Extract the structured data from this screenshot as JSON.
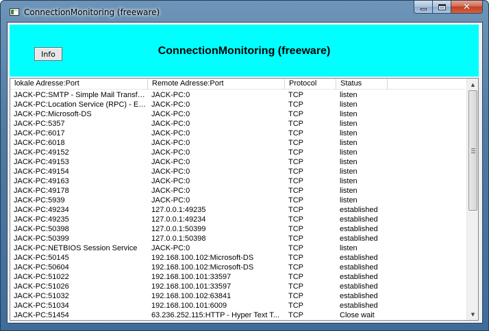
{
  "window": {
    "title": "ConnectionMonitoring (freeware)"
  },
  "header": {
    "info_label": "Info",
    "heading": "ConnectionMonitoring (freeware)",
    "background_color": "#00ffff"
  },
  "table": {
    "columns": [
      "lokale Adresse:Port",
      "Remote Adresse:Port",
      "Protocol",
      "Status"
    ],
    "rows": [
      [
        "JACK-PC:SMTP - Simple Mail Transfer ...",
        "JACK-PC:0",
        "TCP",
        "listen"
      ],
      [
        "JACK-PC:Location Service (RPC) - EP...",
        "JACK-PC:0",
        "TCP",
        "listen"
      ],
      [
        "JACK-PC:Microsoft-DS",
        "JACK-PC:0",
        "TCP",
        "listen"
      ],
      [
        "JACK-PC:5357",
        "JACK-PC:0",
        "TCP",
        "listen"
      ],
      [
        "JACK-PC:6017",
        "JACK-PC:0",
        "TCP",
        "listen"
      ],
      [
        "JACK-PC:6018",
        "JACK-PC:0",
        "TCP",
        "listen"
      ],
      [
        "JACK-PC:49152",
        "JACK-PC:0",
        "TCP",
        "listen"
      ],
      [
        "JACK-PC:49153",
        "JACK-PC:0",
        "TCP",
        "listen"
      ],
      [
        "JACK-PC:49154",
        "JACK-PC:0",
        "TCP",
        "listen"
      ],
      [
        "JACK-PC:49163",
        "JACK-PC:0",
        "TCP",
        "listen"
      ],
      [
        "JACK-PC:49178",
        "JACK-PC:0",
        "TCP",
        "listen"
      ],
      [
        "JACK-PC:5939",
        "JACK-PC:0",
        "TCP",
        "listen"
      ],
      [
        "JACK-PC:49234",
        "127.0.0.1:49235",
        "TCP",
        "established"
      ],
      [
        "JACK-PC:49235",
        "127.0.0.1:49234",
        "TCP",
        "established"
      ],
      [
        "JACK-PC:50398",
        "127.0.0.1:50399",
        "TCP",
        "established"
      ],
      [
        "JACK-PC:50399",
        "127.0.0.1:50398",
        "TCP",
        "established"
      ],
      [
        "JACK-PC:NETBIOS Session Service",
        "JACK-PC:0",
        "TCP",
        "listen"
      ],
      [
        "JACK-PC:50145",
        "192.168.100.102:Microsoft-DS",
        "TCP",
        "established"
      ],
      [
        "JACK-PC:50604",
        "192.168.100.102:Microsoft-DS",
        "TCP",
        "established"
      ],
      [
        "JACK-PC:51022",
        "192.168.100.101:33597",
        "TCP",
        "established"
      ],
      [
        "JACK-PC:51026",
        "192.168.100.101:33597",
        "TCP",
        "established"
      ],
      [
        "JACK-PC:51032",
        "192.168.100.102:63841",
        "TCP",
        "established"
      ],
      [
        "JACK-PC:51034",
        "192.168.100.101:6009",
        "TCP",
        "established"
      ],
      [
        "JACK-PC:51454",
        "63.236.252.115:HTTP - Hyper Text T...",
        "TCP",
        "Close wait"
      ]
    ]
  }
}
